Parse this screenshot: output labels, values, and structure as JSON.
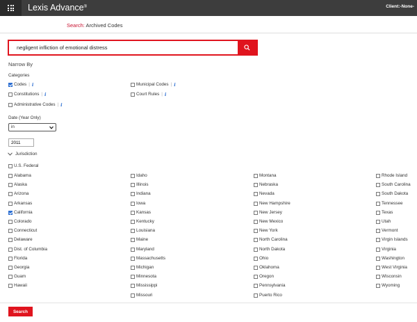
{
  "header": {
    "brand": "Lexis Advance",
    "brand_mark": "®",
    "client": "Client:-None-"
  },
  "breadcrumb": {
    "label": "Search:",
    "value": "Archived Codes"
  },
  "search": {
    "query": "negligent infliction of emotional distress"
  },
  "narrow": {
    "title": "Narrow By",
    "categories_label": "Categories",
    "categories": [
      {
        "label": "Codes",
        "checked": true,
        "info": "i"
      },
      {
        "label": "Constitutions",
        "checked": false,
        "info": "i"
      },
      {
        "label": "Administrative Codes",
        "checked": false,
        "info": "i"
      },
      {
        "label": "Municipal Codes",
        "checked": false,
        "info": "i"
      },
      {
        "label": "Court Rules",
        "checked": false,
        "info": "i"
      }
    ],
    "date_label": "Date (Year Only)",
    "date_operator": "in",
    "date_year": "2011",
    "jurisdiction_label": "Jurisdiction",
    "federal": "U.S. Federal",
    "states": {
      "col1": [
        "Alabama",
        "Alaska",
        "Arizona",
        "Arkansas",
        "California",
        "Colorado",
        "Connecticut",
        "Delaware",
        "Dist. of Columbia",
        "Florida",
        "Georgia",
        "Guam",
        "Hawaii"
      ],
      "col2": [
        "Idaho",
        "Illinois",
        "Indiana",
        "Iowa",
        "Kansas",
        "Kentucky",
        "Louisiana",
        "Maine",
        "Maryland",
        "Massachusetts",
        "Michigan",
        "Minnesota",
        "Mississippi",
        "Missouri"
      ],
      "col3": [
        "Montana",
        "Nebraska",
        "Nevada",
        "New Hampshire",
        "New Jersey",
        "New Mexico",
        "New York",
        "North Carolina",
        "North Dakota",
        "Ohio",
        "Oklahoma",
        "Oregon",
        "Pennsylvania",
        "Puerto Rico"
      ],
      "col4": [
        "Rhode Island",
        "South Carolina",
        "South Dakota",
        "Tennessee",
        "Texas",
        "Utah",
        "Vermont",
        "Virgin Islands",
        "Virginia",
        "Washington",
        "West Virginia",
        "Wisconsin",
        "Wyoming"
      ]
    },
    "checked_states": [
      "California"
    ]
  },
  "submit_label": "Search",
  "colors": {
    "accent": "#e0141e",
    "checkbox": "#2d6fd2",
    "topbar": "#3d3d3d"
  }
}
